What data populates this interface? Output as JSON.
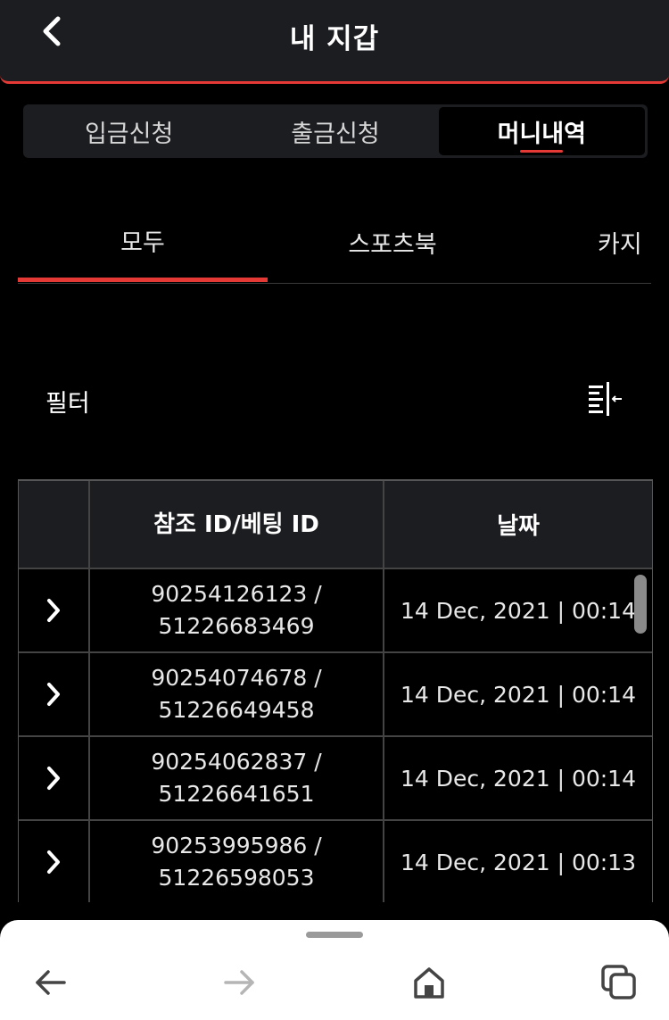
{
  "header": {
    "title": "내 지갑",
    "back_icon": "chevron-left-icon"
  },
  "tabs": [
    {
      "label": "입금신청",
      "active": false
    },
    {
      "label": "출금신청",
      "active": false
    },
    {
      "label": "머니내역",
      "active": true
    }
  ],
  "subtabs": [
    {
      "label": "모두",
      "active": true
    },
    {
      "label": "스포츠북",
      "active": false
    },
    {
      "label": "카지",
      "active": false
    }
  ],
  "filter": {
    "label": "필터",
    "icon": "filter-collapse-icon"
  },
  "table": {
    "headers": [
      "",
      "참조 ID/베팅 ID",
      "날짜"
    ],
    "rows": [
      {
        "ref_id": "90254126123 /",
        "bet_id": "51226683469",
        "date": "14 Dec, 2021 | 00:14"
      },
      {
        "ref_id": "90254074678 /",
        "bet_id": "51226649458",
        "date": "14 Dec, 2021 | 00:14"
      },
      {
        "ref_id": "90254062837 /",
        "bet_id": "51226641651",
        "date": "14 Dec, 2021 | 00:14"
      },
      {
        "ref_id": "90253995986 /",
        "bet_id": "51226598053",
        "date": "14 Dec, 2021 | 00:13"
      }
    ]
  },
  "browser_nav": {
    "icons": [
      "back-arrow-icon",
      "forward-arrow-icon",
      "home-icon",
      "tabs-icon"
    ]
  },
  "colors": {
    "accent": "#e53935",
    "surface": "#1c1d21",
    "background": "#000000"
  }
}
